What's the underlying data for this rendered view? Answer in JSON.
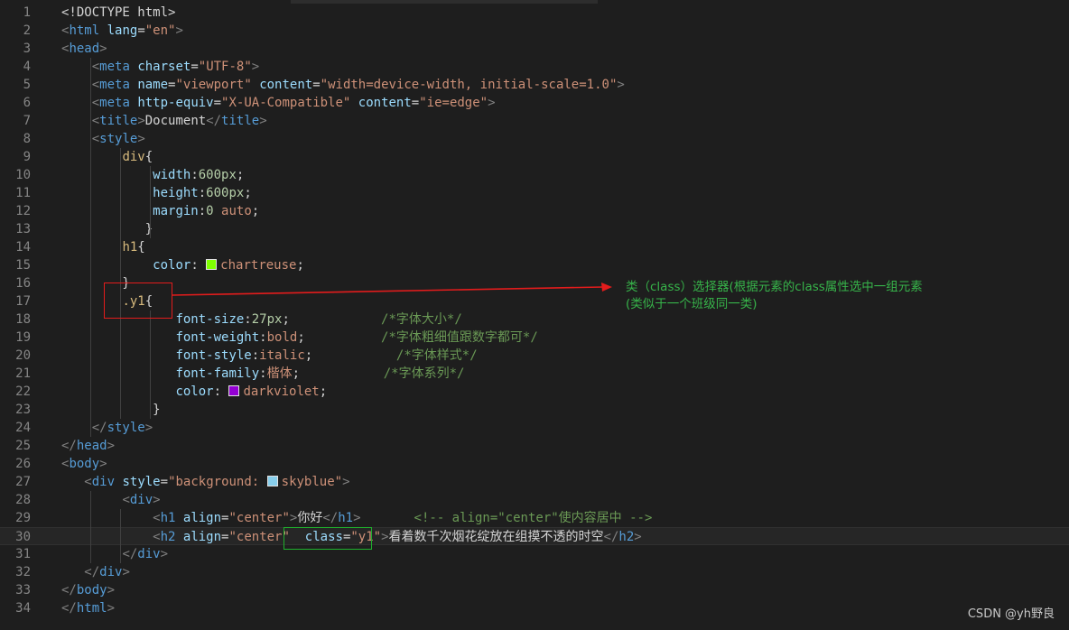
{
  "editor": {
    "lines": [
      {
        "n": "1",
        "tokens": [
          {
            "t": "<!DOCTYPE html>",
            "c": "t-doctype"
          }
        ]
      },
      {
        "n": "2",
        "tokens": [
          {
            "t": "<",
            "c": "t-punc"
          },
          {
            "t": "html",
            "c": "t-tag"
          },
          {
            "t": " ",
            "c": "t-text"
          },
          {
            "t": "lang",
            "c": "t-attr"
          },
          {
            "t": "=",
            "c": "t-text"
          },
          {
            "t": "\"en\"",
            "c": "t-str"
          },
          {
            "t": ">",
            "c": "t-punc"
          }
        ]
      },
      {
        "n": "3",
        "tokens": [
          {
            "t": "<",
            "c": "t-punc"
          },
          {
            "t": "head",
            "c": "t-tag"
          },
          {
            "t": ">",
            "c": "t-punc"
          }
        ]
      },
      {
        "n": "4",
        "tokens": [
          {
            "t": "    ",
            "c": "t-text"
          },
          {
            "t": "<",
            "c": "t-punc"
          },
          {
            "t": "meta",
            "c": "t-tag"
          },
          {
            "t": " ",
            "c": "t-text"
          },
          {
            "t": "charset",
            "c": "t-attr"
          },
          {
            "t": "=",
            "c": "t-text"
          },
          {
            "t": "\"UTF-8\"",
            "c": "t-str"
          },
          {
            "t": ">",
            "c": "t-punc"
          }
        ]
      },
      {
        "n": "5",
        "tokens": [
          {
            "t": "    ",
            "c": "t-text"
          },
          {
            "t": "<",
            "c": "t-punc"
          },
          {
            "t": "meta",
            "c": "t-tag"
          },
          {
            "t": " ",
            "c": "t-text"
          },
          {
            "t": "name",
            "c": "t-attr"
          },
          {
            "t": "=",
            "c": "t-text"
          },
          {
            "t": "\"viewport\"",
            "c": "t-str"
          },
          {
            "t": " ",
            "c": "t-text"
          },
          {
            "t": "content",
            "c": "t-attr"
          },
          {
            "t": "=",
            "c": "t-text"
          },
          {
            "t": "\"width=device-width, initial-scale=1.0\"",
            "c": "t-str"
          },
          {
            "t": ">",
            "c": "t-punc"
          }
        ]
      },
      {
        "n": "6",
        "tokens": [
          {
            "t": "    ",
            "c": "t-text"
          },
          {
            "t": "<",
            "c": "t-punc"
          },
          {
            "t": "meta",
            "c": "t-tag"
          },
          {
            "t": " ",
            "c": "t-text"
          },
          {
            "t": "http-equiv",
            "c": "t-attr"
          },
          {
            "t": "=",
            "c": "t-text"
          },
          {
            "t": "\"X-UA-Compatible\"",
            "c": "t-str"
          },
          {
            "t": " ",
            "c": "t-text"
          },
          {
            "t": "content",
            "c": "t-attr"
          },
          {
            "t": "=",
            "c": "t-text"
          },
          {
            "t": "\"ie=edge\"",
            "c": "t-str"
          },
          {
            "t": ">",
            "c": "t-punc"
          }
        ]
      },
      {
        "n": "7",
        "tokens": [
          {
            "t": "    ",
            "c": "t-text"
          },
          {
            "t": "<",
            "c": "t-punc"
          },
          {
            "t": "title",
            "c": "t-tag"
          },
          {
            "t": ">",
            "c": "t-punc"
          },
          {
            "t": "Document",
            "c": "t-text"
          },
          {
            "t": "</",
            "c": "t-punc"
          },
          {
            "t": "title",
            "c": "t-tag"
          },
          {
            "t": ">",
            "c": "t-punc"
          }
        ]
      },
      {
        "n": "8",
        "tokens": [
          {
            "t": "    ",
            "c": "t-text"
          },
          {
            "t": "<",
            "c": "t-punc"
          },
          {
            "t": "style",
            "c": "t-tag"
          },
          {
            "t": ">",
            "c": "t-punc"
          }
        ]
      },
      {
        "n": "9",
        "tokens": [
          {
            "t": "        ",
            "c": "t-text"
          },
          {
            "t": "div",
            "c": "t-sel"
          },
          {
            "t": "{",
            "c": "t-text"
          }
        ]
      },
      {
        "n": "10",
        "tokens": [
          {
            "t": "            ",
            "c": "t-text"
          },
          {
            "t": "width",
            "c": "t-prop"
          },
          {
            "t": ":",
            "c": "t-text"
          },
          {
            "t": "600px",
            "c": "t-num"
          },
          {
            "t": ";",
            "c": "t-text"
          }
        ]
      },
      {
        "n": "11",
        "tokens": [
          {
            "t": "            ",
            "c": "t-text"
          },
          {
            "t": "height",
            "c": "t-prop"
          },
          {
            "t": ":",
            "c": "t-text"
          },
          {
            "t": "600px",
            "c": "t-num"
          },
          {
            "t": ";",
            "c": "t-text"
          }
        ]
      },
      {
        "n": "12",
        "tokens": [
          {
            "t": "            ",
            "c": "t-text"
          },
          {
            "t": "margin",
            "c": "t-prop"
          },
          {
            "t": ":",
            "c": "t-text"
          },
          {
            "t": "0",
            "c": "t-num"
          },
          {
            "t": " ",
            "c": "t-text"
          },
          {
            "t": "auto",
            "c": "t-val"
          },
          {
            "t": ";",
            "c": "t-text"
          }
        ]
      },
      {
        "n": "13",
        "tokens": [
          {
            "t": "           }",
            "c": "t-text"
          }
        ]
      },
      {
        "n": "14",
        "tokens": [
          {
            "t": "        ",
            "c": "t-text"
          },
          {
            "t": "h1",
            "c": "t-sel"
          },
          {
            "t": "{",
            "c": "t-text"
          }
        ]
      },
      {
        "n": "15",
        "tokens": [
          {
            "t": "            ",
            "c": "t-text"
          },
          {
            "t": "color",
            "c": "t-prop"
          },
          {
            "t": ": ",
            "c": "t-text"
          },
          {
            "t": "",
            "c": "swatch",
            "color": "#7fff00"
          },
          {
            "t": "chartreuse",
            "c": "t-val"
          },
          {
            "t": ";",
            "c": "t-text"
          }
        ]
      },
      {
        "n": "16",
        "tokens": [
          {
            "t": "        }",
            "c": "t-text"
          }
        ]
      },
      {
        "n": "17",
        "tokens": [
          {
            "t": "        ",
            "c": "t-text"
          },
          {
            "t": ".y1",
            "c": "t-sel"
          },
          {
            "t": "{",
            "c": "t-text"
          }
        ]
      },
      {
        "n": "18",
        "tokens": [
          {
            "t": "               ",
            "c": "t-text"
          },
          {
            "t": "font-size",
            "c": "t-prop"
          },
          {
            "t": ":",
            "c": "t-text"
          },
          {
            "t": "27px",
            "c": "t-num"
          },
          {
            "t": ";",
            "c": "t-text"
          },
          {
            "t": "            ",
            "c": "t-text"
          },
          {
            "t": "/*字体大小*/",
            "c": "t-comment"
          }
        ]
      },
      {
        "n": "19",
        "tokens": [
          {
            "t": "               ",
            "c": "t-text"
          },
          {
            "t": "font-weight",
            "c": "t-prop"
          },
          {
            "t": ":",
            "c": "t-text"
          },
          {
            "t": "bold",
            "c": "t-val"
          },
          {
            "t": ";",
            "c": "t-text"
          },
          {
            "t": "          ",
            "c": "t-text"
          },
          {
            "t": "/*字体粗细值跟数字都可*/",
            "c": "t-comment"
          }
        ]
      },
      {
        "n": "20",
        "tokens": [
          {
            "t": "               ",
            "c": "t-text"
          },
          {
            "t": "font-style",
            "c": "t-prop"
          },
          {
            "t": ":",
            "c": "t-text"
          },
          {
            "t": "italic",
            "c": "t-val"
          },
          {
            "t": ";",
            "c": "t-text"
          },
          {
            "t": "           ",
            "c": "t-text"
          },
          {
            "t": "/*字体样式*/",
            "c": "t-comment"
          }
        ]
      },
      {
        "n": "21",
        "tokens": [
          {
            "t": "               ",
            "c": "t-text"
          },
          {
            "t": "font-family",
            "c": "t-prop"
          },
          {
            "t": ":",
            "c": "t-text"
          },
          {
            "t": "楷体",
            "c": "t-val"
          },
          {
            "t": ";",
            "c": "t-text"
          },
          {
            "t": "           ",
            "c": "t-text"
          },
          {
            "t": "/*字体系列*/",
            "c": "t-comment"
          }
        ]
      },
      {
        "n": "22",
        "tokens": [
          {
            "t": "               ",
            "c": "t-text"
          },
          {
            "t": "color",
            "c": "t-prop"
          },
          {
            "t": ": ",
            "c": "t-text"
          },
          {
            "t": "",
            "c": "swatch",
            "color": "#9400d3"
          },
          {
            "t": "darkviolet",
            "c": "t-val"
          },
          {
            "t": ";",
            "c": "t-text"
          }
        ]
      },
      {
        "n": "23",
        "tokens": [
          {
            "t": "            }",
            "c": "t-text"
          }
        ]
      },
      {
        "n": "24",
        "tokens": [
          {
            "t": "    ",
            "c": "t-text"
          },
          {
            "t": "</",
            "c": "t-punc"
          },
          {
            "t": "style",
            "c": "t-tag"
          },
          {
            "t": ">",
            "c": "t-punc"
          }
        ]
      },
      {
        "n": "25",
        "tokens": [
          {
            "t": "</",
            "c": "t-punc"
          },
          {
            "t": "head",
            "c": "t-tag"
          },
          {
            "t": ">",
            "c": "t-punc"
          }
        ]
      },
      {
        "n": "26",
        "tokens": [
          {
            "t": "<",
            "c": "t-punc"
          },
          {
            "t": "body",
            "c": "t-tag"
          },
          {
            "t": ">",
            "c": "t-punc"
          }
        ]
      },
      {
        "n": "27",
        "tokens": [
          {
            "t": "   ",
            "c": "t-text"
          },
          {
            "t": "<",
            "c": "t-punc"
          },
          {
            "t": "div",
            "c": "t-tag"
          },
          {
            "t": " ",
            "c": "t-text"
          },
          {
            "t": "style",
            "c": "t-attr"
          },
          {
            "t": "=",
            "c": "t-text"
          },
          {
            "t": "\"background: ",
            "c": "t-str"
          },
          {
            "t": "",
            "c": "swatch",
            "color": "#87ceeb"
          },
          {
            "t": "skyblue\"",
            "c": "t-str"
          },
          {
            "t": ">",
            "c": "t-punc"
          }
        ]
      },
      {
        "n": "28",
        "tokens": [
          {
            "t": "        ",
            "c": "t-text"
          },
          {
            "t": "<",
            "c": "t-punc"
          },
          {
            "t": "div",
            "c": "t-tag"
          },
          {
            "t": ">",
            "c": "t-punc"
          }
        ]
      },
      {
        "n": "29",
        "tokens": [
          {
            "t": "            ",
            "c": "t-text"
          },
          {
            "t": "<",
            "c": "t-punc"
          },
          {
            "t": "h1",
            "c": "t-tag"
          },
          {
            "t": " ",
            "c": "t-text"
          },
          {
            "t": "align",
            "c": "t-attr"
          },
          {
            "t": "=",
            "c": "t-text"
          },
          {
            "t": "\"center\"",
            "c": "t-str"
          },
          {
            "t": ">",
            "c": "t-punc"
          },
          {
            "t": "你好",
            "c": "t-text"
          },
          {
            "t": "</",
            "c": "t-punc"
          },
          {
            "t": "h1",
            "c": "t-tag"
          },
          {
            "t": ">",
            "c": "t-punc"
          },
          {
            "t": "       ",
            "c": "t-text"
          },
          {
            "t": "<!-- align=\"center\"使内容居中 -->",
            "c": "t-comment"
          }
        ]
      },
      {
        "n": "30",
        "tokens": [
          {
            "t": "            ",
            "c": "t-text"
          },
          {
            "t": "<",
            "c": "t-punc"
          },
          {
            "t": "h2",
            "c": "t-tag"
          },
          {
            "t": " ",
            "c": "t-text"
          },
          {
            "t": "align",
            "c": "t-attr"
          },
          {
            "t": "=",
            "c": "t-text"
          },
          {
            "t": "\"center\"",
            "c": "t-str"
          },
          {
            "t": "  ",
            "c": "t-text"
          },
          {
            "t": "class",
            "c": "t-attr"
          },
          {
            "t": "=",
            "c": "t-text"
          },
          {
            "t": "\"y1\"",
            "c": "t-str"
          },
          {
            "t": ">",
            "c": "t-punc"
          },
          {
            "t": "看着数千次烟花绽放在组摸不透的时空",
            "c": "t-text"
          },
          {
            "t": "</",
            "c": "t-punc"
          },
          {
            "t": "h2",
            "c": "t-tag"
          },
          {
            "t": ">",
            "c": "t-punc"
          }
        ]
      },
      {
        "n": "31",
        "tokens": [
          {
            "t": "        ",
            "c": "t-text"
          },
          {
            "t": "</",
            "c": "t-punc"
          },
          {
            "t": "div",
            "c": "t-tag"
          },
          {
            "t": ">",
            "c": "t-punc"
          }
        ]
      },
      {
        "n": "32",
        "tokens": [
          {
            "t": "   ",
            "c": "t-text"
          },
          {
            "t": "</",
            "c": "t-punc"
          },
          {
            "t": "div",
            "c": "t-tag"
          },
          {
            "t": ">",
            "c": "t-punc"
          }
        ]
      },
      {
        "n": "33",
        "tokens": [
          {
            "t": "</",
            "c": "t-punc"
          },
          {
            "t": "body",
            "c": "t-tag"
          },
          {
            "t": ">",
            "c": "t-punc"
          }
        ]
      },
      {
        "n": "34",
        "tokens": [
          {
            "t": "</",
            "c": "t-punc"
          },
          {
            "t": "html",
            "c": "t-tag"
          },
          {
            "t": ">",
            "c": "t-punc"
          }
        ]
      }
    ],
    "current_line": "30"
  },
  "annotation": {
    "note_line1": "类（class）选择器(根据元素的class属性选中一组元素",
    "note_line2": "(类似于一个班级同一类)",
    "highlight_color": "#e31c1c",
    "note_color": "#37b44a"
  },
  "watermark": {
    "text": "CSDN @yh野良"
  }
}
